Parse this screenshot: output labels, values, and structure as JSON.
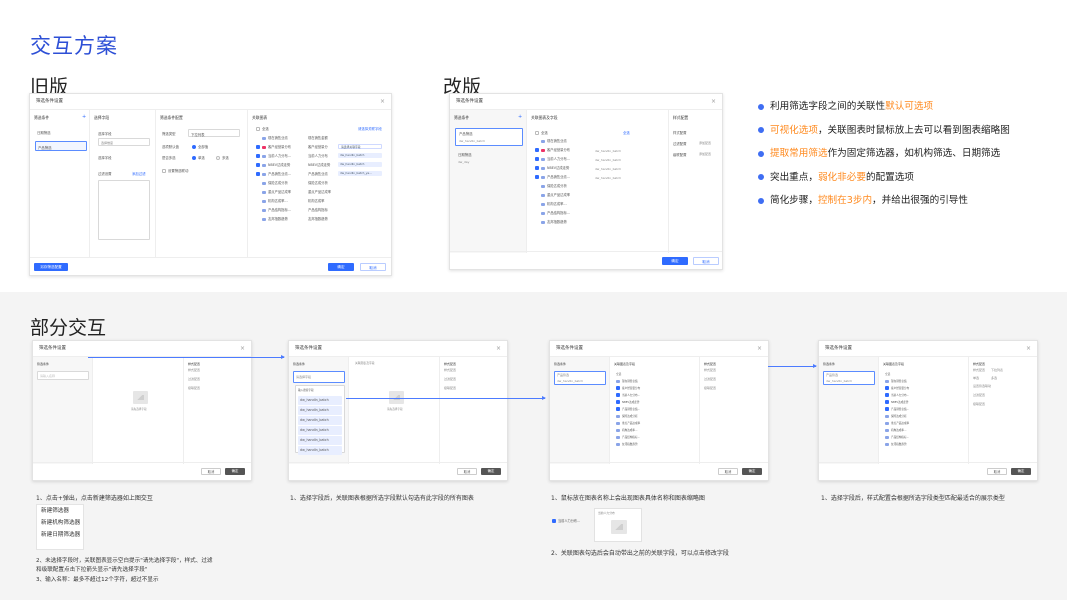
{
  "titles": {
    "main": "交互方案",
    "old": "旧版",
    "new": "改版",
    "partial": "部分交互"
  },
  "dialog": {
    "title": "筛选条件设置",
    "close": "×",
    "confirm": "确定",
    "cancel": "取消",
    "save_new_label": "另存筛选配置"
  },
  "old_dialog": {
    "col1_header": "筛选条件",
    "col2_header": "选择字段",
    "col3_header": "筛选条件配置",
    "col4_header": "关联图表",
    "add": "+",
    "items": [
      "日期筛选",
      "产品筛选"
    ],
    "field_label": "选择字段",
    "field_value": "选择维度",
    "filter_label": "过滤设置",
    "filter_link": "添加过滤",
    "type_label": "筛选类型",
    "type_value": "下拉列表",
    "default_label": "选项默认值",
    "default_value": "全部值",
    "multi_label": "是否多选",
    "multi_yes": "单选",
    "multi_no": "多选",
    "cascade_label": "设置筛选联动",
    "all": "全选",
    "assoc_link": "请选择关联字段",
    "charts": [
      "现在销售业绩",
      "客户经营量分布",
      "当前人力分布...",
      "NBEV达成走势",
      "产品销售业绩...",
      "保险达成分析",
      "重点产品达成率",
      "机构达成率...",
      "产品结构指标...",
      "友邦指数趋势"
    ],
    "fields": [
      "现在销售金额",
      "客户经营量分",
      "当前人力分布",
      "NBEV达成走势",
      "产品销售业绩",
      "保险达成分析",
      "重点产品达成率",
      "机构达成率",
      "产品结构指标",
      "友邦指数趋势"
    ],
    "field_tags": [
      "请选择关联字段",
      "dw_handln_batch",
      "dw_handln_batch",
      "dw_handln_batch_ya..."
    ]
  },
  "new_dialog": {
    "col1_header": "筛选条件",
    "col2_header": "关联图表及字段",
    "col3_header": "样式配置",
    "items": [
      {
        "name": "产品筛选",
        "field": "dw_handln_batch"
      },
      {
        "name": "日期筛选",
        "field": "dw_day"
      }
    ],
    "all": "全选",
    "assoc_link": "全选",
    "charts": [
      "现在销售业绩",
      "客户经营量分布",
      "当前人力分布...",
      "NBEV达成走势",
      "产品销售业绩...",
      "保险达成分析",
      "重点产品达成率",
      "机构达成率...",
      "产品结构指标...",
      "友邦指数趋势"
    ],
    "chart_fields": [
      "dw_handln_batch",
      "dw_handln_batch",
      "dw_handln_batch",
      "dw_handln_batch"
    ],
    "style_rows": [
      {
        "label": "样式配置",
        "value": ""
      },
      {
        "label": "过滤配置",
        "value": "添加配置"
      },
      {
        "label": "级联配置",
        "value": "添加配置"
      }
    ]
  },
  "bullets": [
    {
      "pre": "利用筛选字段之间的关联性",
      "hl": "默认可选项",
      "post": ""
    },
    {
      "pre": "",
      "hl": "可视化选项",
      "post": "，关联图表时鼠标放上去可以看到图表缩略图"
    },
    {
      "pre": "",
      "hl": "提取常用筛选",
      "post": "作为固定筛选器，如机构筛选、日期筛选"
    },
    {
      "pre": "突出重点，",
      "hl": "弱化非必要",
      "post": "的配置选项"
    },
    {
      "pre": "简化步骤，",
      "hl": "控制在3步内",
      "post": "，并给出很强的引导性"
    }
  ],
  "partial": {
    "d1": {
      "col1": "筛选条件",
      "placeholder": "请输入名称",
      "style_rows": [
        "样式配置",
        "过滤配置",
        "级联配置"
      ],
      "empty": "请先选择字段",
      "col3": "样式配置"
    },
    "d2": {
      "col1": "筛选条件",
      "col2": "关联图表及字段",
      "placeholder": "请选择字段",
      "opts": [
        "输入搜索字段",
        "dw_handln_batch",
        "dw_handln_batch",
        "dw_handln_batch",
        "dw_handln_batch",
        "dw_handln_batch",
        "dw_handln_batch"
      ],
      "col3": "样式配置",
      "empty": "请先选择字段"
    },
    "d3": {
      "col1": "筛选条件",
      "item": "产品筛选",
      "field": "dw_handln_batch",
      "col2": "关联图表及字段",
      "col3": "样式配置"
    },
    "d4": {
      "col1": "筛选条件",
      "item": "产品筛选",
      "field": "dw_handln_batch",
      "col2": "关联图表及字段",
      "col3": "样式配置",
      "type": "下拉列表",
      "single": "单选",
      "multi": "多选",
      "cascade": "设置筛选联动"
    }
  },
  "captions": {
    "c1": "1、点击+弹出，点击新建筛选器如上图交互",
    "menu": [
      "新建筛选器",
      "新建机构筛选器",
      "新建日期筛选器"
    ],
    "c1b": "2、未选择字段时，关联图表显示空白提示\"请先选择字段\"，样式、过滤",
    "c1c": "和级联配置点击下拉箭头显示\"请先选择字段\"",
    "c1d": "3、输入名称：最多不超过12个字符，超过不显示",
    "c2": "1、选择字段后，关联图表根据所选字段默认勾选有此字段的所有图表",
    "c3": "1、鼠标放在图表名称上会出现图表具体名称和图表缩略图",
    "c3_chart": "当前人力分布...",
    "c3_thumb": "当前人力分布",
    "c3b": "2、关联图表勾选后会自动带出之前的关联字段，可以点击修改字段",
    "c4": "1、选择字段后，样式配置会根据所选字段类型匹配最适合的展示类型"
  }
}
